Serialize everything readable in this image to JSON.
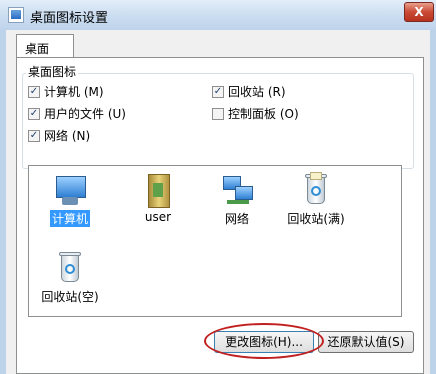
{
  "window": {
    "title": "桌面图标设置",
    "close_label": "X"
  },
  "tabs": [
    {
      "label": "桌面"
    }
  ],
  "desktop_icons_group": {
    "label": "桌面图标",
    "checkboxes": [
      {
        "label": "计算机 (M)",
        "checked": true
      },
      {
        "label": "回收站 (R)",
        "checked": true
      },
      {
        "label": "用户的文件 (U)",
        "checked": true
      },
      {
        "label": "控制面板 (O)",
        "checked": false
      },
      {
        "label": "网络 (N)",
        "checked": true
      }
    ]
  },
  "icon_list": [
    {
      "label": "计算机",
      "icon": "computer-icon",
      "selected": true
    },
    {
      "label": "user",
      "icon": "user-folder-icon",
      "selected": false
    },
    {
      "label": "网络",
      "icon": "network-icon",
      "selected": false
    },
    {
      "label": "回收站(满)",
      "icon": "recycle-bin-full-icon",
      "selected": false
    },
    {
      "label": "回收站(空)",
      "icon": "recycle-bin-empty-icon",
      "selected": false
    }
  ],
  "buttons": {
    "change_icon": "更改图标(H)...",
    "restore_default": "还原默认值(S)"
  },
  "colors": {
    "selection": "#3399ff",
    "highlight_ring": "#c02020",
    "close_button": "#c94a35"
  }
}
